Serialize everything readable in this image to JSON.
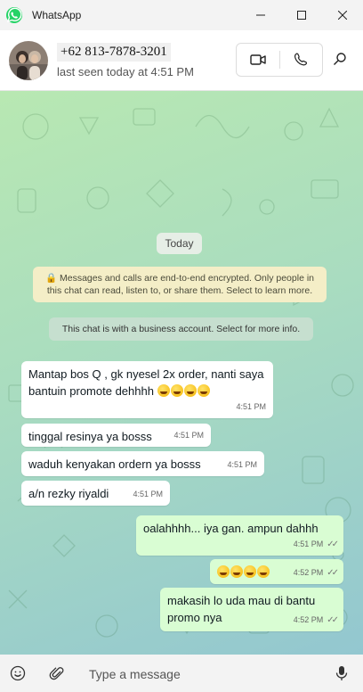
{
  "window": {
    "app_name": "WhatsApp"
  },
  "header": {
    "contact_name": "+62 813-7878-3201",
    "status": "last seen today at 4:51 PM"
  },
  "chat": {
    "date_pill": "Today",
    "encryption_notice": "🔒 Messages and calls are end-to-end encrypted. Only people in this chat can read, listen to, or share them. Select to learn more.",
    "business_notice": "This chat is with a business account. Select for more info.",
    "messages": [
      {
        "dir": "in",
        "text": "Mantap bos Q , gk nyesel 2x order, nanti saya bantuin promote dehhhh",
        "time": "4:51 PM"
      },
      {
        "dir": "in",
        "text": "tinggal resinya ya bosss",
        "time": "4:51 PM"
      },
      {
        "dir": "in",
        "text": "waduh kenyakan ordern ya bosss",
        "time": "4:51 PM"
      },
      {
        "dir": "in",
        "text": "a/n rezky riyaldi",
        "time": "4:51 PM"
      },
      {
        "dir": "out",
        "text": "oalahhhh... iya gan. ampun dahhh",
        "time": "4:51 PM"
      },
      {
        "dir": "out",
        "text": "",
        "time": "4:52 PM"
      },
      {
        "dir": "out",
        "text": "makasih lo uda mau di bantu promo nya",
        "time": "4:52 PM"
      }
    ]
  },
  "composer": {
    "placeholder": "Type a message"
  },
  "colors": {
    "accent": "#25d366",
    "outgoing_bubble": "#d9fdd3",
    "incoming_bubble": "#ffffff"
  }
}
